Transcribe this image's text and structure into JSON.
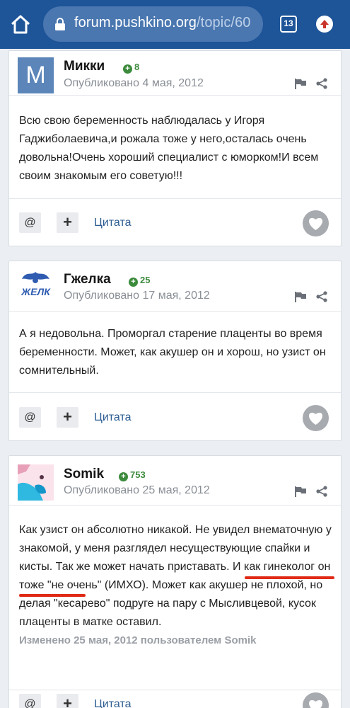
{
  "browser": {
    "url_main": "forum.pushkino.org",
    "url_rest": "/topic/60",
    "tab_count": "13"
  },
  "posts": [
    {
      "author": "Микки",
      "avatar_letter": "M",
      "avatar_color": "#5c86ba",
      "reputation": "8",
      "posted": "Опубликовано 4 мая, 2012",
      "body": "Всю свою беременность наблюдалась у Игоря Гаджиболаевича,и рожала тоже у него,осталась очень довольна!Очень хороший специалист с юморком!И всем своим знакомым его советую!!!",
      "quote_label": "Цитата"
    },
    {
      "author": "Гжелка",
      "avatar_text": "ЖЕЛК",
      "reputation": "25",
      "posted": "Опубликовано 17 мая, 2012",
      "body": "А я недовольна. Проморгал старение плаценты во время беременности. Может, как акушер он и хорош, но узист он сомнительный.",
      "quote_label": "Цитата"
    },
    {
      "author": "Somik",
      "reputation": "753",
      "posted": "Опубликовано 25 мая, 2012",
      "body_part1": "Как узист он абсолютно никакой. Не увидел внематочную у знакомой, у меня разглядел несуществующие спайки и кисты. Так же ",
      "body_highlight": "может начать приставать",
      "body_part2": ". И как гинеколог он тоже \"не очень\" (ИМХО). Может как акушер не плохой, но делая \"кесарево\" подруге на пару с Мысливцевой, кусок плаценты в матке оставил.",
      "edited": "Изменено 25 мая, 2012 пользователем Somik",
      "quote_label": "Цитата"
    }
  ],
  "colors": {
    "chrome": "#1e5498",
    "reputation": "#3c8a3c",
    "link": "#2d5d92",
    "highlight_underline": "#e02a16"
  },
  "icons": [
    "home-icon",
    "lock-icon",
    "tabs-icon",
    "upload-icon",
    "flag-icon",
    "share-icon",
    "mention-icon",
    "plus-icon",
    "heart-icon"
  ]
}
